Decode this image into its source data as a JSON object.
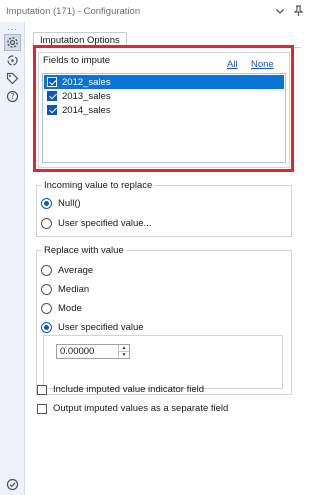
{
  "window": {
    "title": "Imputation (171) - Configuration"
  },
  "tabs": [
    {
      "label": "Imputation Options"
    }
  ],
  "fields": {
    "label": "Fields to impute",
    "all_link": "All",
    "none_link": "None",
    "items": [
      {
        "label": "2012_sales",
        "checked": true,
        "selected": true
      },
      {
        "label": "2013_sales",
        "checked": true,
        "selected": false
      },
      {
        "label": "2014_sales",
        "checked": true,
        "selected": false
      }
    ]
  },
  "incoming": {
    "title": "Incoming value to replace",
    "options": [
      {
        "label": "Null()",
        "selected": true
      },
      {
        "label": "User specified value...",
        "selected": false
      }
    ]
  },
  "replace": {
    "title": "Replace with value",
    "options": [
      {
        "label": "Average",
        "selected": false
      },
      {
        "label": "Median",
        "selected": false
      },
      {
        "label": "Mode",
        "selected": false
      },
      {
        "label": "User specified value",
        "selected": true
      }
    ],
    "value": "0.00000"
  },
  "checkboxes": [
    {
      "label": "Include imputed value indicator field",
      "checked": false
    },
    {
      "label": "Output imputed values as a separate field",
      "checked": false
    }
  ],
  "colors": {
    "accent": "#0f56c2",
    "highlight": "#e8232a",
    "selection": "#0a73d9"
  }
}
